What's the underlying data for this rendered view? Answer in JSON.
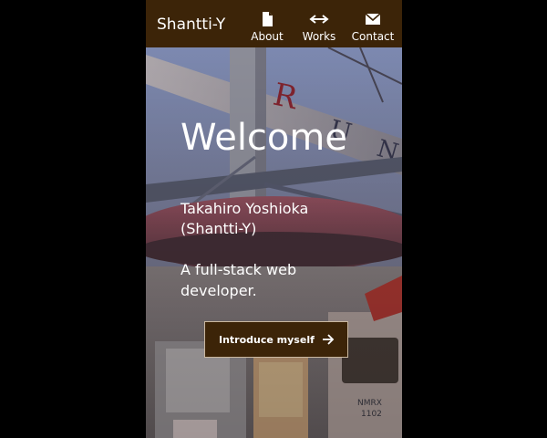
{
  "header": {
    "brand": "Shantti-Y",
    "nav": [
      {
        "label": "About",
        "icon": "document-icon"
      },
      {
        "label": "Works",
        "icon": "code-arrows-icon"
      },
      {
        "label": "Contact",
        "icon": "envelope-icon"
      }
    ]
  },
  "hero": {
    "welcome": "Welcome",
    "name": "Takahiro Yoshioka\n(Shantti-Y)",
    "tagline": "A full-stack web developer.",
    "cta_label": "Introduce myself",
    "cta_icon": "arrow-right-icon",
    "photo_sign_letters": "R U N",
    "photo_train_text": "NMRX\n1102"
  },
  "colors": {
    "header_bg": "#3c2408",
    "cta_bg": "#3c2408",
    "text": "#ffffff",
    "page_bg": "#000000"
  }
}
